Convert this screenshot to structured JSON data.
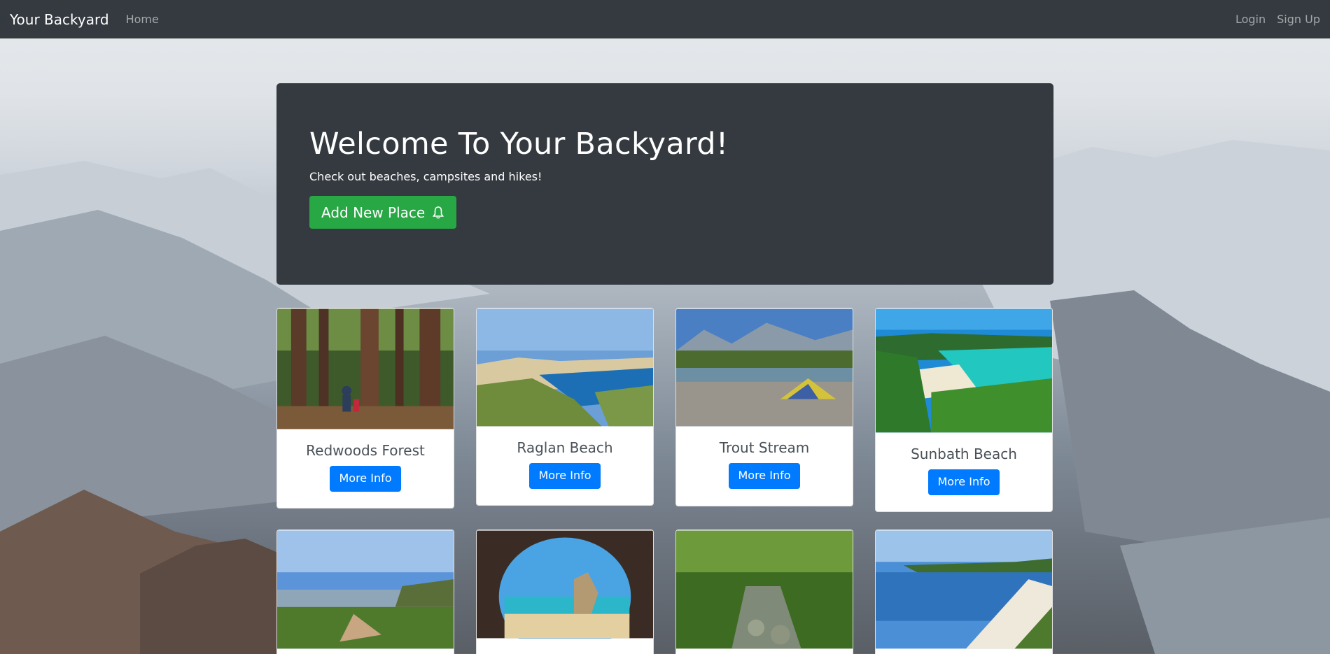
{
  "nav": {
    "brand": "Your Backyard",
    "home": "Home",
    "login": "Login",
    "signup": "Sign Up"
  },
  "hero": {
    "title": "Welcome To Your Backyard!",
    "subtitle": "Check out beaches, campsites and hikes!",
    "add_button": "Add New Place"
  },
  "cards": [
    {
      "title": "Redwoods Forest",
      "button": "More Info"
    },
    {
      "title": "Raglan Beach",
      "button": "More Info"
    },
    {
      "title": "Trout Stream",
      "button": "More Info"
    },
    {
      "title": "Sunbath Beach",
      "button": "More Info"
    }
  ],
  "colors": {
    "navbar": "#343a40",
    "success": "#28a745",
    "primary": "#007bff"
  }
}
